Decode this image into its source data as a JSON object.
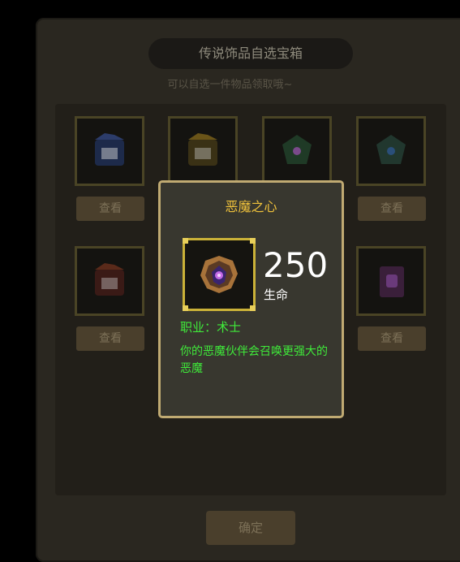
{
  "chest": {
    "title": "传说饰品自选宝箱",
    "subtitle": "可以自选一件物品领取哦~",
    "view_label": "查看",
    "confirm_label": "确定",
    "items": [
      {
        "icon": "blue-armor-icon"
      },
      {
        "icon": "gold-armor-icon"
      },
      {
        "icon": "green-amulet-icon"
      },
      {
        "icon": "teal-amulet-icon"
      },
      {
        "icon": "red-armor-icon"
      },
      {
        "icon": "purple-tome-icon"
      }
    ]
  },
  "tooltip": {
    "title": "恶魔之心",
    "stat_value": "250",
    "stat_label": "生命",
    "class_line": "职业：术士",
    "description": "你的恶魔伙伴会召唤更强大的恶魔",
    "icon": "demon-heart-icon"
  },
  "colors": {
    "title_gold": "#f0c23b",
    "effect_green": "#3fe93a",
    "frame_gold": "#c0aa72"
  }
}
